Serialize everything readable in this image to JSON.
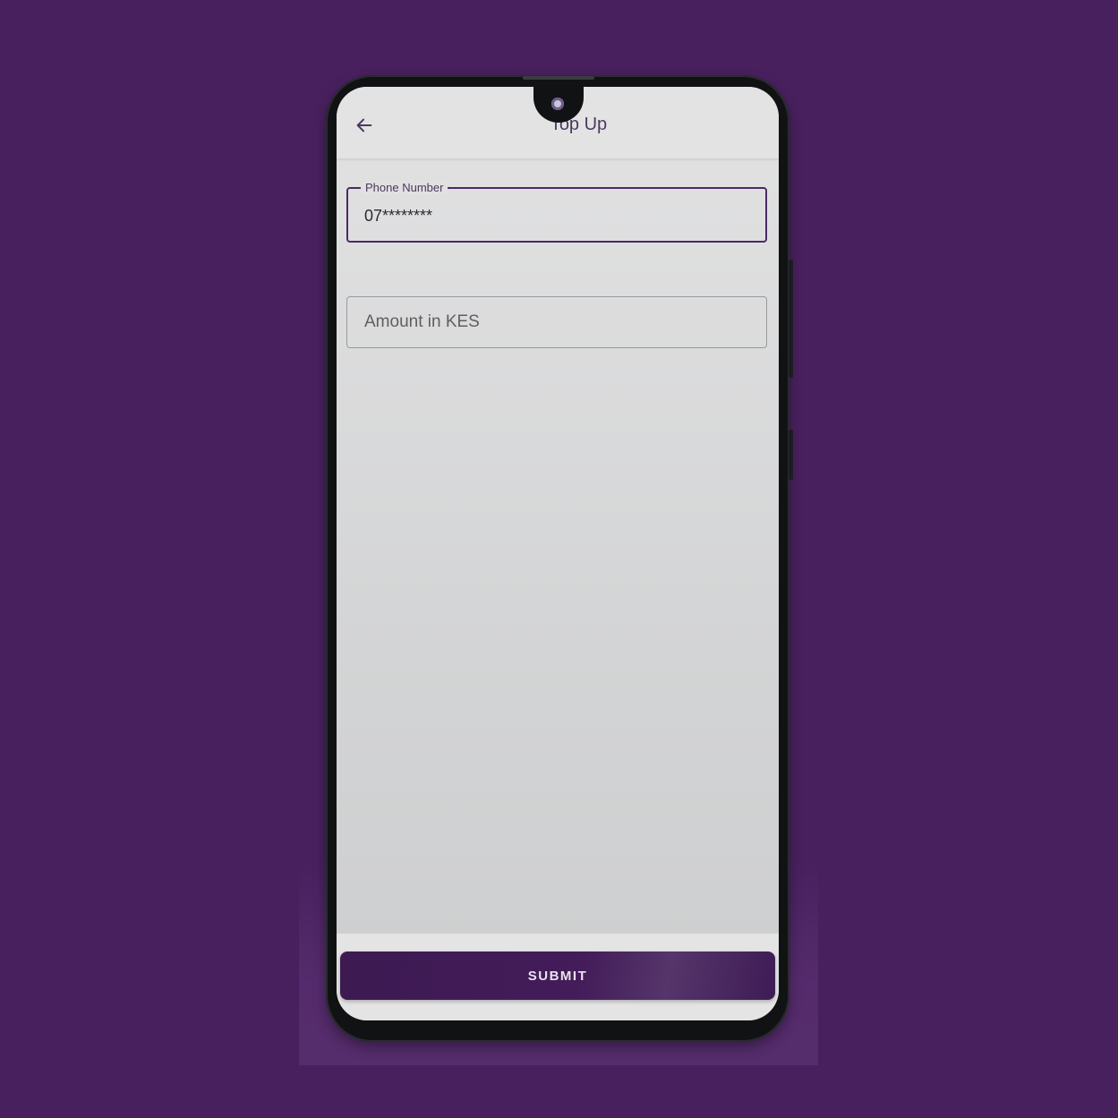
{
  "colors": {
    "background": "#48205e",
    "accent": "#4b2a64",
    "screen": "#e2e2e3",
    "button": "#431c59"
  },
  "appbar": {
    "back_icon": "arrow-left-icon",
    "title": "Top Up"
  },
  "form": {
    "phone": {
      "label": "Phone Number",
      "value": "07********"
    },
    "amount": {
      "placeholder": "Amount in KES",
      "value": ""
    }
  },
  "submit": {
    "label": "SUBMIT"
  }
}
